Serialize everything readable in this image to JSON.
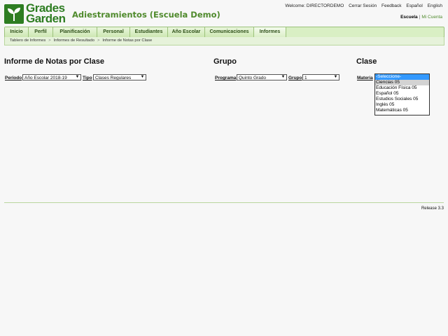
{
  "logo": {
    "line1": "Grades",
    "line2": "Garden"
  },
  "school_name": "Adiestramientos (Escuela Demo)",
  "toplinks": {
    "welcome": "Welcome: DIRECTORDEMO",
    "logout": "Cerrar Sesión",
    "feedback": "Feedback",
    "spanish": "Español",
    "english": "English"
  },
  "school_switch": {
    "active": "Escuela",
    "other": "Mi Cuenta"
  },
  "nav": [
    "Inicio",
    "Perfil",
    "Planificación",
    "Personal",
    "Estudiantes",
    "Año Escolar",
    "Comunicaciones",
    "Informes"
  ],
  "breadcrumb": [
    "Tablero de Informes",
    "Informes de Resultado",
    "Informe de Notas por Clase"
  ],
  "report_section": {
    "title": "Informe de Notas por Clase",
    "period_label": "Periodo",
    "period_value": "Año Escolar 2018-19",
    "type_label": "Tipo",
    "type_value": "Clases Regulares"
  },
  "group_section": {
    "title": "Grupo",
    "program_label": "Programa",
    "program_value": "Quinto Grado",
    "group_label": "Grupo",
    "group_value": "1"
  },
  "class_section": {
    "title": "Clase",
    "subject_label": "Materia",
    "options": [
      "-Seleccione-",
      "Ciencias 05",
      "Educación Física 05",
      "Español 05",
      "Estudios Sociales 05",
      "Inglés 05",
      "Matemáticas 05"
    ]
  },
  "release": "Release 3.3",
  "colors": {
    "brand_green": "#2e7d22",
    "nav_bg": "#d9efc4",
    "accent": "#4f8a2c",
    "selected": "#3399ff"
  }
}
